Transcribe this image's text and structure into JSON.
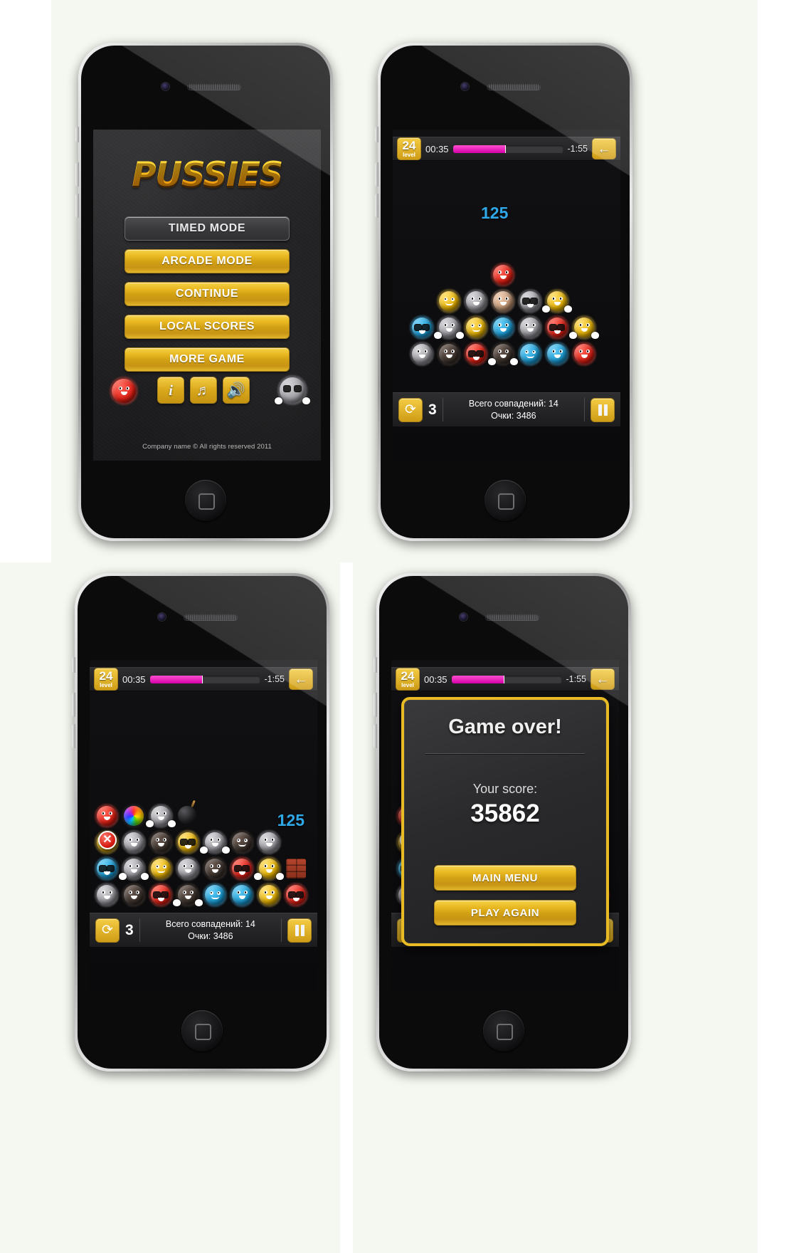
{
  "app": {
    "title": "PUSSIES",
    "copyright": "Company name © All rights reserved 2011"
  },
  "colors": {
    "gold": "#e8bb24",
    "gold_dark": "#c59312",
    "magenta": "#d400a8",
    "score_blue": "#2fa8e8",
    "red_ball": "#e01f14"
  },
  "menu": {
    "buttons": [
      {
        "label": "TIMED MODE",
        "style": "ghost"
      },
      {
        "label": "ARCADE MODE",
        "style": "gold"
      },
      {
        "label": "CONTINUE",
        "style": "gold"
      },
      {
        "label": "LOCAL SCORES",
        "style": "gold"
      },
      {
        "label": "MORE GAME",
        "style": "gold"
      }
    ],
    "icons": [
      {
        "name": "info-icon",
        "glyph": "i"
      },
      {
        "name": "music-icon",
        "glyph": "♬"
      },
      {
        "name": "sound-icon",
        "glyph": "🔊"
      }
    ],
    "mascot_left": "red-fuzzy-mascot",
    "mascot_right": "grey-glasses-fuzzy-mascot"
  },
  "hud": {
    "level_number": "24",
    "level_label": "level",
    "timer": "00:35",
    "progress_percent": 48,
    "countdown": "-1:55",
    "back_icon": "←",
    "swap_icon": "⟳",
    "swap_count": "3",
    "matches_line": "Всего совпадений: 14",
    "score_line": "Очки: 3486",
    "pause_icon": "pause-bars",
    "score_popup": "125"
  },
  "gameover": {
    "title": "Game over!",
    "score_label": "Your score:",
    "score_value": "35862",
    "buttons": [
      {
        "label": "MAIN MENU"
      },
      {
        "label": "PLAY AGAIN"
      }
    ]
  },
  "board2": {
    "rows": [
      [
        "red"
      ],
      [
        "yellow",
        "grey",
        "tan",
        "grey",
        "yellow"
      ],
      [
        "blue",
        "grey",
        "yellow",
        "blue",
        "grey",
        "red",
        "yellow"
      ],
      [
        "grey",
        "dark",
        "red",
        "dark",
        "blue",
        "blue",
        "red"
      ]
    ]
  },
  "board3": {
    "specials": {
      "rainbow": "rainbow-ball",
      "bomb": "bomb-ball",
      "brick": "brick-block",
      "cancel": "cancel-icon"
    },
    "rows": [
      [
        "red",
        "rainbow",
        "grey",
        "bomb"
      ],
      [
        "yellow",
        "grey",
        "dark",
        "yellow",
        "grey",
        "dark",
        "grey"
      ],
      [
        "blue",
        "grey",
        "yellow",
        "grey",
        "dark",
        "red",
        "yellow",
        "brick"
      ],
      [
        "grey",
        "dark",
        "red",
        "dark",
        "blue",
        "blue",
        "yellow",
        "red"
      ]
    ]
  }
}
